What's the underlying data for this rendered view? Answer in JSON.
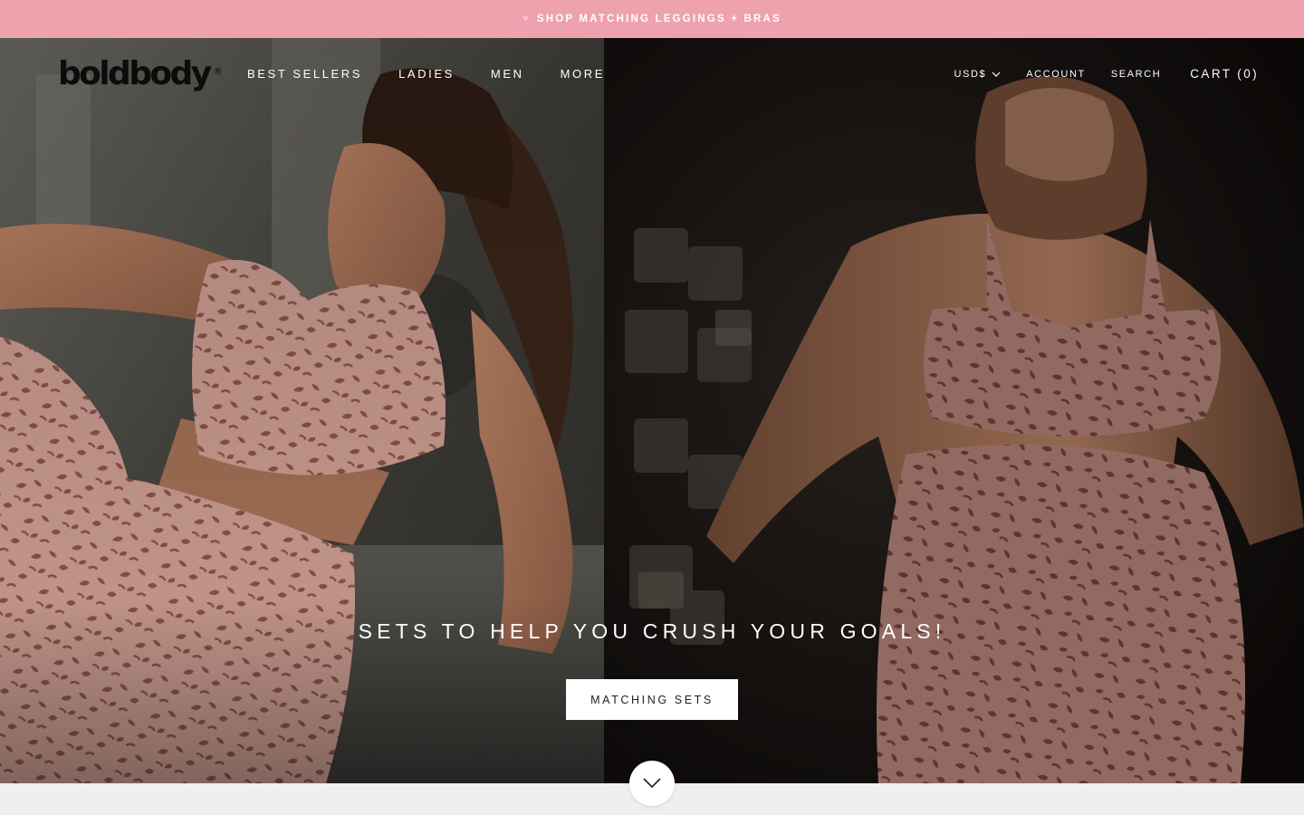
{
  "announcement": {
    "icon": "heart-icon",
    "text": "SHOP MATCHING LEGGINGS + BRAS",
    "background": "#eea2ae",
    "icon_color": "#f7c3e4"
  },
  "header": {
    "logo": "boldbody",
    "logo_mark": "®",
    "nav": [
      {
        "label": "BEST SELLERS"
      },
      {
        "label": "LADIES"
      },
      {
        "label": "MEN"
      },
      {
        "label": "MORE"
      }
    ],
    "currency": {
      "label": "USD$",
      "icon": "chevron-down-icon"
    },
    "account_label": "ACCOUNT",
    "search_label": "SEARCH",
    "cart_label": "CART (0)"
  },
  "hero": {
    "title": "SETS TO HELP YOU CRUSH YOUR GOALS!",
    "button_label": "MATCHING SETS",
    "scroll_icon": "chevron-down-icon",
    "overlay_color": "#120e0c",
    "print_color": "#c99b8f",
    "spot_color": "#8a5149"
  }
}
